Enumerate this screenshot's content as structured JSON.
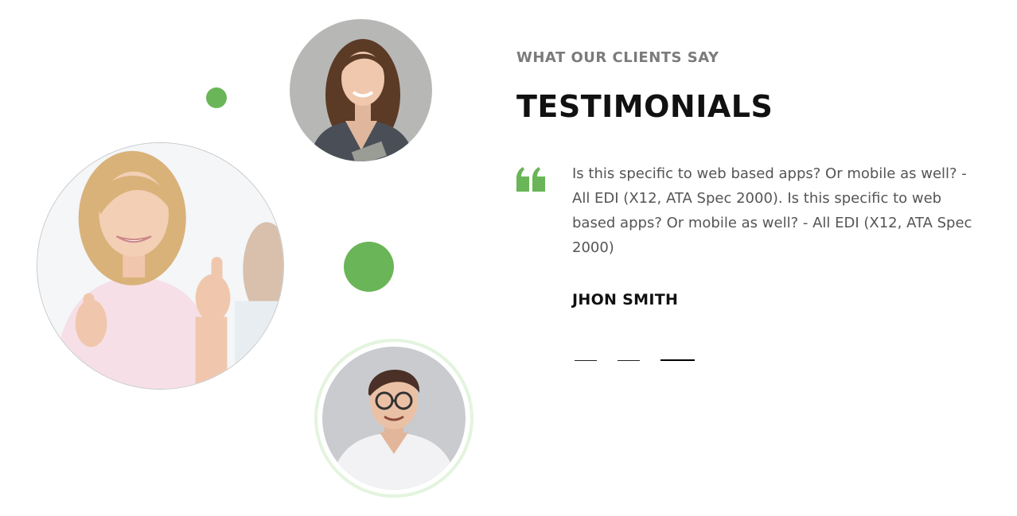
{
  "section": {
    "eyebrow": "WHAT OUR CLIENTS SAY",
    "title": "TESTIMONIALS"
  },
  "testimonial": {
    "quote": "Is this specific to web based apps? Or mobile as well? - All EDI (X12, ATA Spec 2000). Is this specific to web based apps? Or mobile as well? - All EDI (X12, ATA Spec 2000)",
    "author": "JHON SMITH",
    "quote_icon": "quote-icon"
  },
  "slider": {
    "slide_count": 3,
    "active_index": 2
  },
  "colors": {
    "accent": "#6ab557",
    "accent_light": "#e3f4de",
    "heading": "#111111",
    "body": "#555555",
    "muted": "#7b7b7b"
  }
}
